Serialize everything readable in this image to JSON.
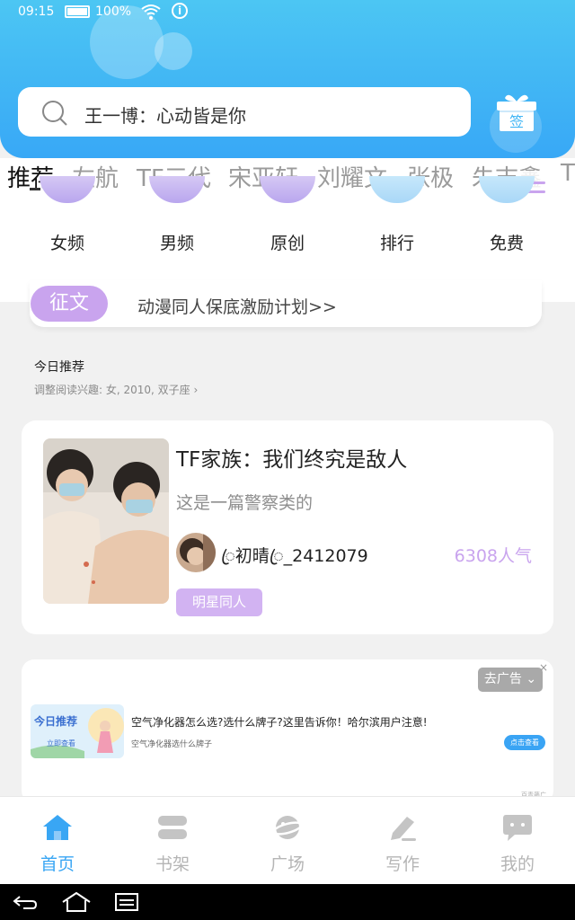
{
  "status_bar": {
    "time": "09:15",
    "battery": "100%"
  },
  "search": {
    "placeholder": "王一博：心动皆是你"
  },
  "gift": {
    "label": "签"
  },
  "tabs": [
    "推荐",
    "左航",
    "TF三代",
    "宋亚轩",
    "刘耀文",
    "张极",
    "朱志鑫",
    "T"
  ],
  "categories": [
    "女频",
    "男频",
    "原创",
    "排行",
    "免费"
  ],
  "banner": {
    "tag": "征文",
    "text": "动漫同人保底激励计划>>"
  },
  "recommend": {
    "title": "今日推荐",
    "subtitle": "调整阅读兴趣: 女, 2010, 双子座"
  },
  "book": {
    "title": "TF家族：我们终究是敌人",
    "description": "这是一篇警察类的",
    "author": "ꦿ初晴ꦿ_2412079",
    "popularity": "6308人气",
    "genre": "明星同人"
  },
  "ad": {
    "button": "去广告",
    "close": "×",
    "image_label": "今日推荐",
    "image_sub": "立即查看",
    "title": "空气净化器怎么选?选什么牌子?这里告诉你！哈尔滨用户注意!",
    "subtitle": "空气净化器选什么牌子",
    "cta": "点击查看",
    "source": "百青藤广"
  },
  "bottom_nav": [
    {
      "label": "首页",
      "icon": "home-icon",
      "active": true
    },
    {
      "label": "书架",
      "icon": "bookshelf-icon",
      "active": false
    },
    {
      "label": "广场",
      "icon": "planet-icon",
      "active": false
    },
    {
      "label": "写作",
      "icon": "pen-icon",
      "active": false
    },
    {
      "label": "我的",
      "icon": "chat-bubble-icon",
      "active": false
    }
  ],
  "colors": {
    "header": "#3fb5f5",
    "accent_purple": "#c9a4ee",
    "nav_active": "#39a6f4"
  }
}
